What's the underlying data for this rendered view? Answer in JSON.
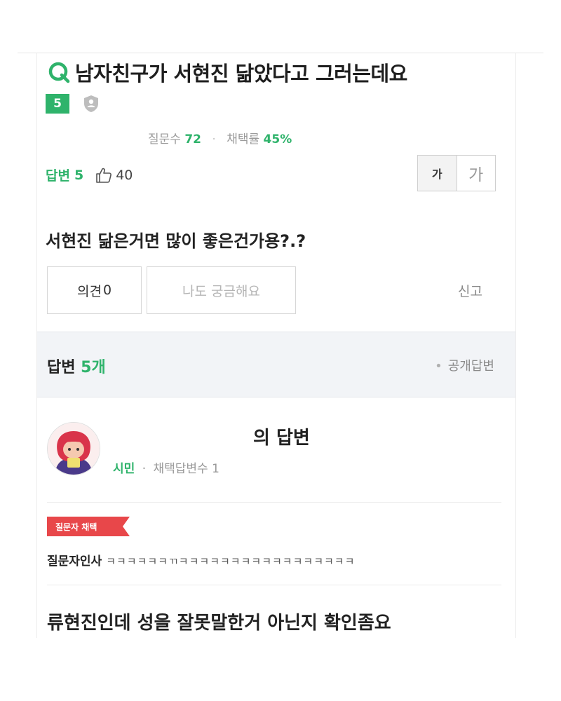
{
  "question": {
    "icon": "q-icon",
    "title": "남자친구가 서현진 닮았다고 그러는데요",
    "level": "5",
    "stats": {
      "questions_label": "질문수",
      "questions_count": "72",
      "adoption_label": "채택률",
      "adoption_rate": "45%"
    },
    "answers_label": "답변",
    "answers_count": "5",
    "likes": "40",
    "font_small_label": "가",
    "font_large_label": "가",
    "body": "서현진 닮은거면 많이 좋은건가용?.?",
    "opinion_label": "의견",
    "opinion_count": "0",
    "curious_label": "나도 궁금해요",
    "report_label": "신고"
  },
  "answers_section": {
    "title_prefix": "답변",
    "count": "5개",
    "public_label": "공개답변"
  },
  "answer": {
    "author_suffix": "의 답변",
    "role": "시민",
    "meta": "채택답변수 1",
    "chosen_tag": "질문자 채택",
    "greeting_label": "질문자인사",
    "greeting_text": "ㅋㅋㅋㅋㅋㅋㄲㅋㅋㅋㅋㅋㅋㅋㅋㅋㅋㅋㅋㅋㅋㅋㅋㅋ",
    "body": "류현진인데 성을 잘못말한거 아닌지 확인좀요"
  },
  "colors": {
    "accent_green": "#2fb36b",
    "chosen_red": "#e8474a",
    "section_bg": "#f2f4f7"
  }
}
